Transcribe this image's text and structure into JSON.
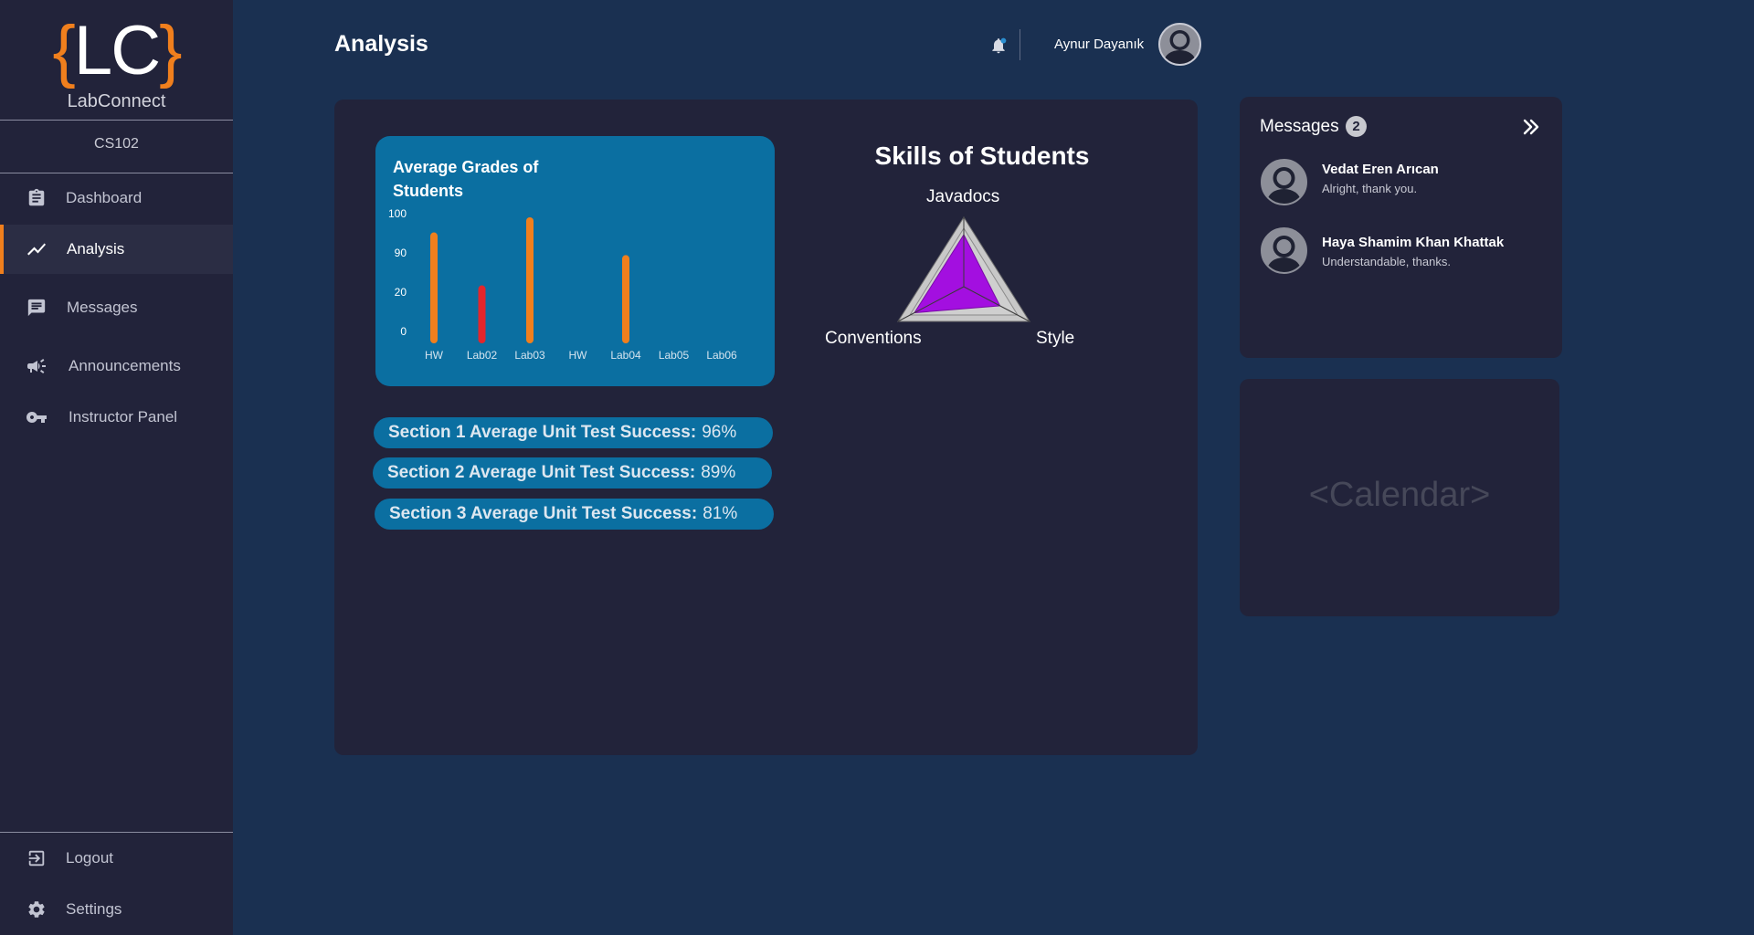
{
  "app": {
    "brand_open_brace": "{",
    "brand_letters": "LC",
    "brand_close_brace": "}",
    "brand_name": "LabConnect",
    "course": "CS102",
    "accent_color": "#f07f1d"
  },
  "sidebar": {
    "items": [
      {
        "label": "Dashboard",
        "icon": "clipboard-icon",
        "active": false
      },
      {
        "label": "Analysis",
        "icon": "trending-icon",
        "active": true
      },
      {
        "label": "Messages",
        "icon": "chat-icon",
        "active": false
      },
      {
        "label": "Announcements",
        "icon": "megaphone-icon",
        "active": false
      },
      {
        "label": "Instructor Panel",
        "icon": "key-icon",
        "active": false
      }
    ],
    "footer": [
      {
        "label": "Logout",
        "icon": "logout-icon"
      },
      {
        "label": "Settings",
        "icon": "gear-icon"
      }
    ]
  },
  "header": {
    "title": "Analysis",
    "user_name": "Aynur Dayanık"
  },
  "grades_chart": {
    "title": "Average Grades of Students",
    "chart_data": {
      "type": "bar",
      "title": "Average Grades of Students",
      "categories": [
        "HW",
        "Lab02",
        "Lab03",
        "HW",
        "Lab04",
        "Lab05",
        "Lab06"
      ],
      "y_tick_labels": [
        "100",
        "90",
        "20",
        "0"
      ],
      "values": [
        88,
        46,
        100,
        null,
        70,
        null,
        null
      ],
      "colors": [
        "#f07f1d",
        "#e3262b",
        "#f07f1d",
        null,
        "#f07f1d",
        null,
        null
      ]
    }
  },
  "skills_chart": {
    "title": "Skills of Students",
    "chart_data": {
      "type": "radar",
      "axes": [
        "Javadocs",
        "Conventions",
        "Style"
      ],
      "values": [
        0.75,
        0.75,
        0.55
      ],
      "fill_color": "#a30fe0"
    }
  },
  "section_stats": [
    {
      "label": "Section 1 Average Unit Test Success:",
      "value": "96%"
    },
    {
      "label": "Section 2 Average Unit Test Success:",
      "value": "89%"
    },
    {
      "label": "Section 3 Average Unit Test Success:",
      "value": "81%"
    }
  ],
  "messages": {
    "title": "Messages",
    "unread_count": "2",
    "items": [
      {
        "sender": "Vedat Eren Arıcan",
        "text": "Alright, thank you."
      },
      {
        "sender": "Haya Shamim Khan Khattak",
        "text": "Understandable, thanks."
      }
    ]
  },
  "calendar": {
    "placeholder": "<Calendar>"
  }
}
